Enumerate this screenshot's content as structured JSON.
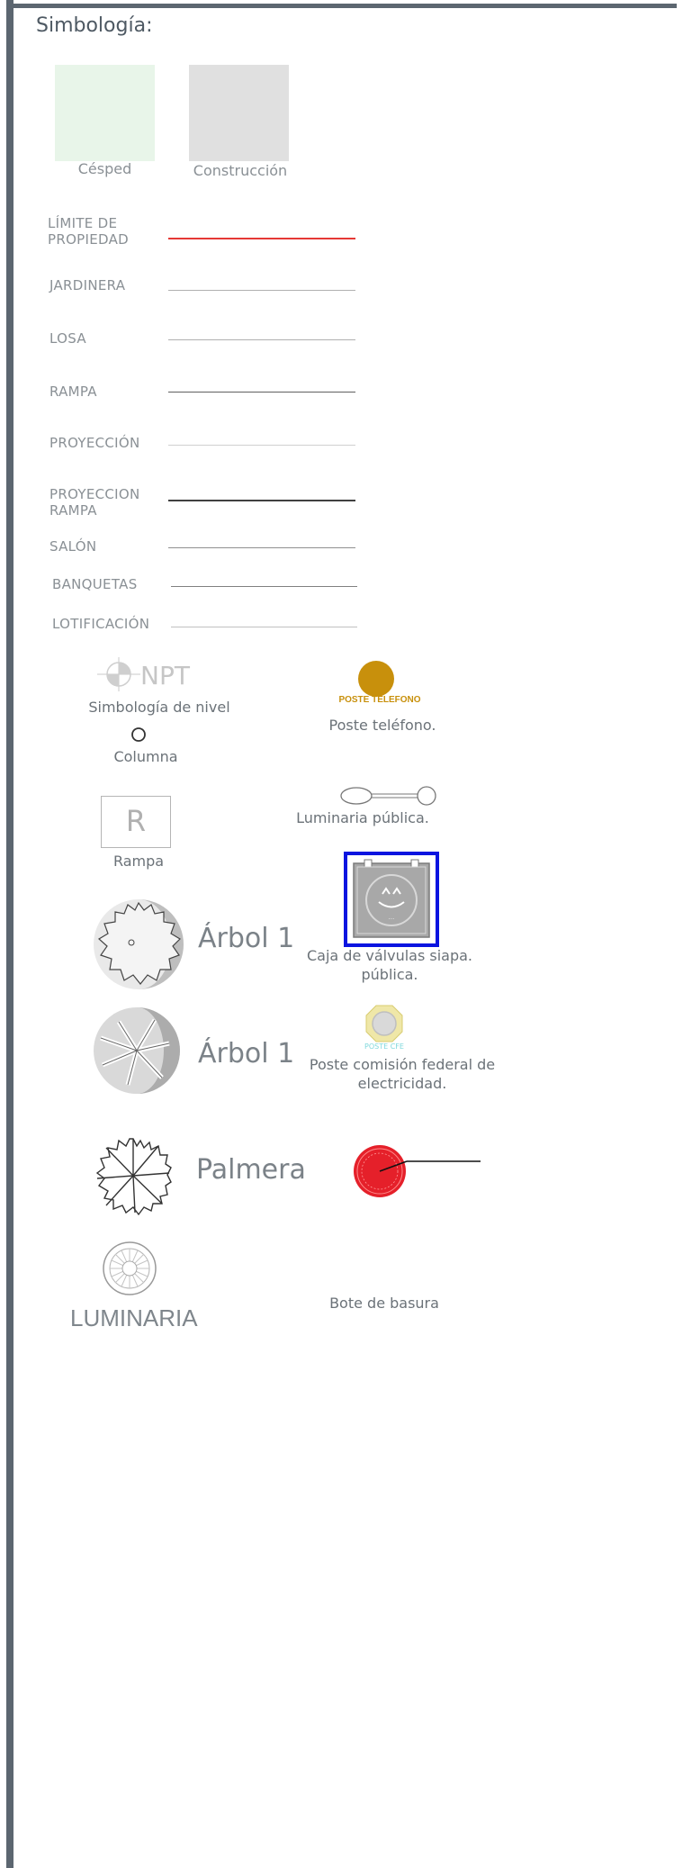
{
  "title": "Simbología:",
  "swatches": [
    {
      "label": "Césped",
      "color": "#e8f5e9"
    },
    {
      "label": "Construcción",
      "color": "#e0e0e0"
    }
  ],
  "lines": [
    {
      "label": "LÍMITE DE\nPROPIEDAD",
      "color": "#e53935"
    },
    {
      "label": "JARDINERA",
      "color": "#b0b0b0"
    },
    {
      "label": "LOSA",
      "color": "#b0b0b0"
    },
    {
      "label": "RAMPA",
      "color": "#606060"
    },
    {
      "label": "PROYECCIÓN",
      "color": "#d0d0d0"
    },
    {
      "label": "PROYECCION\nRAMPA",
      "color": "#404040"
    },
    {
      "label": "SALÓN",
      "color": "#909090"
    },
    {
      "label": "BANQUETAS",
      "color": "#808080"
    },
    {
      "label": "LOTIFICACIÓN",
      "color": "#c0c0c0"
    }
  ],
  "symbols": {
    "npt_text": "NPT",
    "nivel": "Simbología de nivel",
    "columna": "Columna",
    "rampa_letter": "R",
    "rampa": "Rampa",
    "arbol1a": "Árbol 1",
    "arbol1b": "Árbol 1",
    "palmera": "Palmera",
    "luminaria": "LUMINARIA",
    "poste_tel_tag": "POSTE TELEFONO",
    "poste_tel": "Poste teléfono.",
    "luminaria_publica": "Luminaria pública.",
    "caja_valvulas": "Caja de válvulas siapa. pública.",
    "poste_cfe_tag": "POSTE CFE",
    "poste_cfe": "Poste comisión federal de electricidad.",
    "bote": "Bote de basura"
  }
}
